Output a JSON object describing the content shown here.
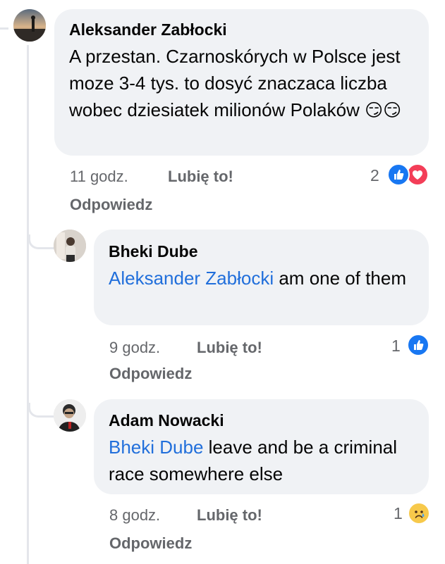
{
  "comments": [
    {
      "author": "Aleksander Zabłocki",
      "text": "A przestan. Czarnoskórych w Polsce jest moze 3-4 tys. to dosyć znaczaca liczba wobec dziesiatek milionów Polaków",
      "emojis": "😏😏",
      "time": "11 godz.",
      "like_label": "Lubię to!",
      "reply_label": "Odpowiedz",
      "reaction_count": "2",
      "reactions": [
        "like-icon",
        "love-icon"
      ],
      "colors": {
        "like": "#1877f2",
        "love": "#f33e58"
      }
    },
    {
      "author": "Bheki Dube",
      "mention": "Aleksander Zabłocki",
      "text": " am one of them",
      "time": "9 godz.",
      "like_label": "Lubię to!",
      "reply_label": "Odpowiedz",
      "reaction_count": "1",
      "reactions": [
        "like-icon"
      ]
    },
    {
      "author": "Adam Nowacki",
      "mention": "Bheki Dube",
      "text": " leave and be a criminal race somewhere else",
      "time": "8 godz.",
      "like_label": "Lubię to!",
      "reply_label": "Odpowiedz",
      "reaction_count": "1",
      "reactions": [
        "sad-icon"
      ]
    }
  ]
}
